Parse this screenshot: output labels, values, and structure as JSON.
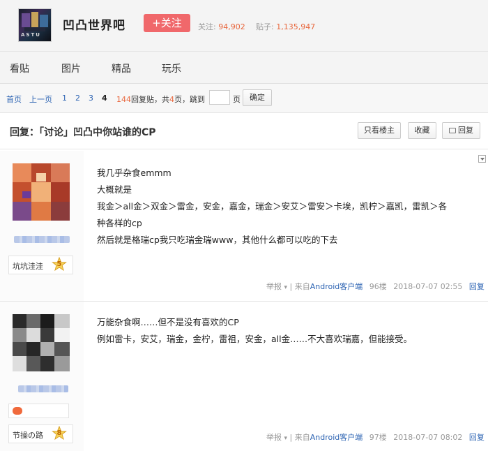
{
  "forum": {
    "name": "凹凸世界吧",
    "follow_label": "+关注",
    "followers_label": "关注:",
    "followers_count": "94,902",
    "posts_label": "贴子:",
    "posts_count": "1,135,947",
    "logo_icon": "forum-avatar-icon"
  },
  "nav": {
    "tabs": [
      "看贴",
      "图片",
      "精品",
      "玩乐"
    ]
  },
  "pager": {
    "first": "首页",
    "prev": "上一页",
    "pages": [
      "1",
      "2",
      "3"
    ],
    "current": "4",
    "reply_count": "144",
    "reply_suffix": "回复贴，共",
    "total_pages": "4",
    "pages_suffix": "页，",
    "jump_label": "跳到",
    "page_unit": "页",
    "confirm_label": "确定"
  },
  "thread": {
    "title": "回复：「讨论」凹凸中你站谁的CP",
    "only_op_label": "只看楼主",
    "favorite_label": "收藏",
    "reply_label": "回复"
  },
  "posts": [
    {
      "lines": [
        "我几乎杂食emmm",
        "大概就是",
        "我金＞all金＞双金＞雷金，安金，嘉金，瑞金＞安艾＞雷安＞卡埃，凯柠＞嘉凯，雷凯＞各",
        "种各样的cp",
        "然后就是格瑞cp我只吃瑞金瑞www，其他什么都可以吃的下去"
      ],
      "level_title": "坑坑洼洼",
      "level": "5",
      "report": "举报",
      "source_prefix": "| 来自",
      "source": "Android客户端",
      "floor": "96楼",
      "time": "2018-07-07 02:55",
      "reply": "回复"
    },
    {
      "lines": [
        "万能杂食啊……但不是没有喜欢的CP",
        "例如雷卡，安艾，瑞金，金柠，雷祖，安金，all金……不大喜欢瑞嘉，但能接受。"
      ],
      "level_title": "节操の路",
      "level": "8",
      "report": "举报",
      "source_prefix": "| 来自",
      "source": "Android客户端",
      "floor": "97楼",
      "time": "2018-07-07 08:02",
      "reply": "回复"
    }
  ],
  "colors": {
    "accent": "#f0686b",
    "link": "#2d64b3",
    "count": "#e8663c"
  }
}
